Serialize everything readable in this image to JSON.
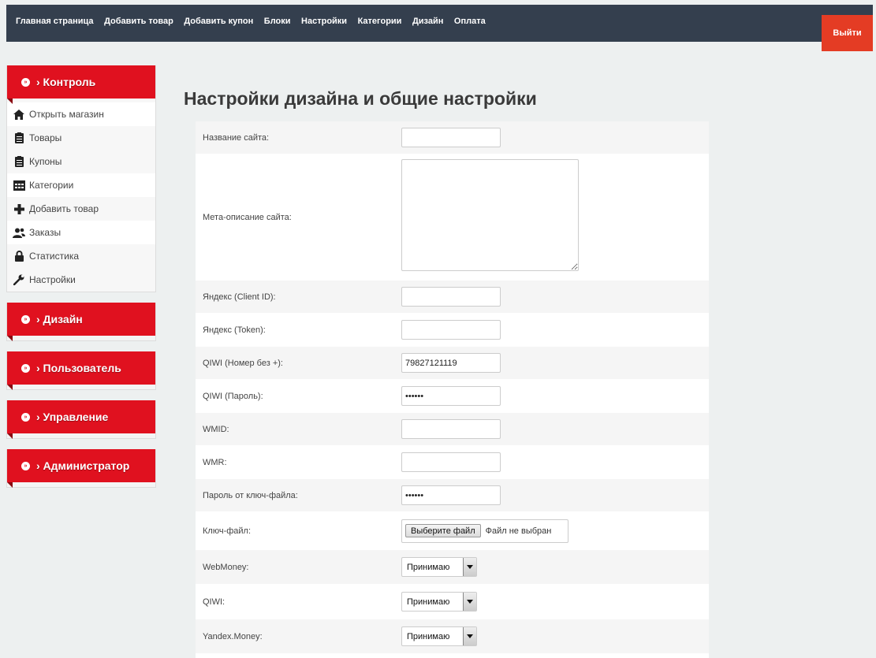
{
  "topnav": {
    "items": [
      "Главная страница",
      "Добавить товар",
      "Добавить купон",
      "Блоки",
      "Настройки",
      "Категории",
      "Дизайн",
      "Оплата"
    ],
    "logout": "Выйти"
  },
  "sidebar": {
    "control": {
      "title": "› Контроль",
      "items": [
        {
          "label": "Открыть магазин",
          "icon": "home-icon"
        },
        {
          "label": "Товары",
          "icon": "clipboard-icon"
        },
        {
          "label": "Купоны",
          "icon": "clipboard-icon"
        },
        {
          "label": "Категории",
          "icon": "calendar-icon"
        },
        {
          "label": "Добавить товар",
          "icon": "plus-icon"
        },
        {
          "label": "Заказы",
          "icon": "users-icon"
        },
        {
          "label": "Статистика",
          "icon": "lock-icon"
        },
        {
          "label": "Настройки",
          "icon": "wrench-icon"
        }
      ]
    },
    "sections": [
      "› Дизайн",
      "› Пользователь",
      "› Управление",
      "› Администратор"
    ]
  },
  "main": {
    "title": "Настройки дизайна и общие настройки",
    "fields": {
      "site_name": {
        "label": "Название сайта:",
        "value": ""
      },
      "meta": {
        "label": "Мета-описание сайта:",
        "value": ""
      },
      "yandex_client": {
        "label": "Яндекс (Client ID):",
        "value": ""
      },
      "yandex_token": {
        "label": "Яндекс (Token):",
        "value": ""
      },
      "qiwi_number": {
        "label": "QIWI (Номер без +):",
        "value": "79827121119"
      },
      "qiwi_password": {
        "label": "QIWI (Пароль):",
        "value": "abcdef"
      },
      "wmid": {
        "label": "WMID:",
        "value": ""
      },
      "wmr": {
        "label": "WMR:",
        "value": ""
      },
      "key_password": {
        "label": "Пароль от ключ-файла:",
        "value": "abcdef"
      },
      "key_file": {
        "label": "Ключ-файл:",
        "button": "Выберите файл",
        "status": "Файл не выбран"
      },
      "webmoney": {
        "label": "WebMoney:",
        "value": "Принимаю"
      },
      "qiwi": {
        "label": "QIWI:",
        "value": "Принимаю"
      },
      "yandex_money": {
        "label": "Yandex.Money:",
        "value": "Принимаю"
      }
    }
  },
  "colors": {
    "topbar": "#343f4e",
    "accent_red": "#e0111f",
    "logout": "#e43c24"
  }
}
